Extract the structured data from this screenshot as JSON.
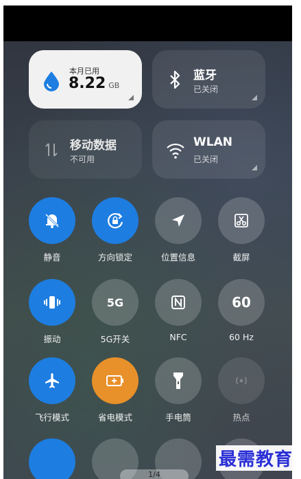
{
  "tiles": {
    "data_usage": {
      "label": "本月已用",
      "value": "8.22",
      "unit": "GB"
    },
    "bluetooth": {
      "title": "蓝牙",
      "status": "已关闭"
    },
    "mobile_data": {
      "title": "移动数据",
      "status": "不可用"
    },
    "wlan": {
      "title": "WLAN",
      "status": "已关闭"
    }
  },
  "buttons": [
    {
      "label": "静音",
      "icon": "mute-bell-icon",
      "state": "active"
    },
    {
      "label": "方向锁定",
      "icon": "rotation-lock-icon",
      "state": "active"
    },
    {
      "label": "位置信息",
      "icon": "location-arrow-icon",
      "state": "inactive"
    },
    {
      "label": "截屏",
      "icon": "scissors-screenshot-icon",
      "state": "inactive"
    },
    {
      "label": "振动",
      "icon": "vibrate-icon",
      "state": "active"
    },
    {
      "label": "5G开关",
      "icon_text": "5G",
      "icon": "5g-icon",
      "state": "inactive"
    },
    {
      "label": "NFC",
      "icon": "nfc-icon",
      "state": "inactive"
    },
    {
      "label": "60 Hz",
      "icon_text": "60",
      "icon": "refresh-rate-icon",
      "state": "inactive"
    },
    {
      "label": "飞行模式",
      "icon": "airplane-icon",
      "state": "active"
    },
    {
      "label": "省电模式",
      "icon": "battery-saver-icon",
      "state": "active-orange"
    },
    {
      "label": "手电筒",
      "icon": "flashlight-icon",
      "state": "inactive"
    },
    {
      "label": "热点",
      "icon": "hotspot-icon",
      "state": "disabled"
    }
  ],
  "pager": {
    "text": "1/4"
  },
  "watermark": {
    "text": "最需教育"
  },
  "colors": {
    "accent_blue": "#1e7de0",
    "accent_orange": "#e8902a"
  }
}
